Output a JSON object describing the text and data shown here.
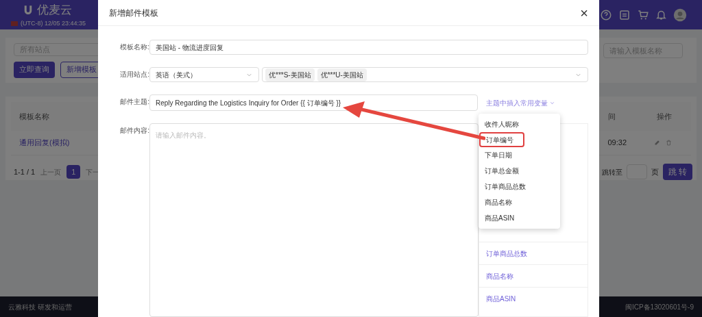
{
  "app": {
    "logo": "优麦云",
    "clock": "(UTC-8) 12/05 23:44:35",
    "site_filter": {
      "placeholder": "所有站点"
    },
    "query_button": "立即查询",
    "new_button": "新增模板",
    "name_filter": {
      "placeholder": "请输入模板名称"
    },
    "table": {
      "columns": [
        "模板名称",
        "间",
        "操作"
      ],
      "rows": [
        {
          "name": "通用回复(模拟)",
          "time": "09:32"
        }
      ]
    },
    "pagination": {
      "summary": "1-1 / 1",
      "prev": "上一页",
      "page": "1",
      "next": "下一",
      "goto_label": "跳转至",
      "page_unit": "页",
      "goto_button": "跳 转"
    },
    "footer": {
      "left": "云雅科技 研发和运营",
      "right": "闽ICP备13020601号-9"
    }
  },
  "dialog": {
    "title": "新增邮件模板",
    "close": "×",
    "fields": [
      {
        "label": "模板名称:",
        "value": "美国站 - 物流进度回复"
      },
      {
        "label": "适用站点:",
        "language": "英语（美式）",
        "tags": [
          "优***S-美国站",
          "优***U-美国站"
        ]
      },
      {
        "label": "邮件主题:",
        "value": "Reply Regarding the Logistics Inquiry for Order {{ 订单编号 }}",
        "insert_link": "主题中插入常用变量"
      },
      {
        "label": "邮件内容:",
        "placeholder": "请输入邮件内容。"
      }
    ],
    "variable_panel": [
      "订单商品总数",
      "商品名称",
      "商品ASIN"
    ],
    "variable_menu": [
      {
        "label": "收件人昵称",
        "annotated": false
      },
      {
        "label": "订单编号",
        "annotated": true
      },
      {
        "label": "下单日期",
        "annotated": false
      },
      {
        "label": "订单总金额",
        "annotated": false
      },
      {
        "label": "订单商品总数",
        "annotated": false
      },
      {
        "label": "商品名称",
        "annotated": false
      },
      {
        "label": "商品ASIN",
        "annotated": false
      }
    ]
  }
}
